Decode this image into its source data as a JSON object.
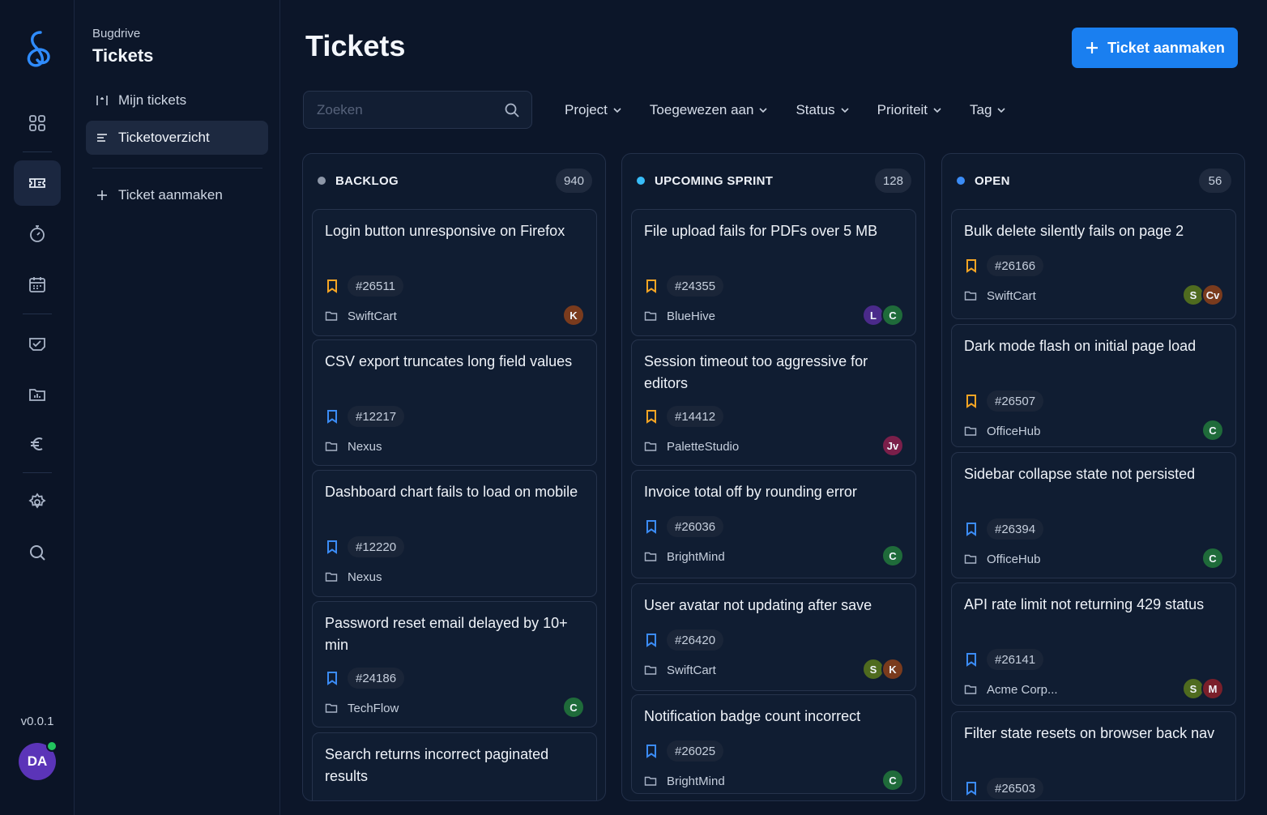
{
  "app": {
    "subtitle": "Bugdrive",
    "title": "Tickets",
    "version": "v0.0.1",
    "user_initials": "DA"
  },
  "nav": {
    "items": [
      {
        "label": "Mijn tickets"
      },
      {
        "label": "Ticketoverzicht"
      },
      {
        "label": "Ticket aanmaken"
      }
    ]
  },
  "header": {
    "title": "Tickets",
    "create_label": "Ticket aanmaken",
    "search_placeholder": "Zoeken"
  },
  "filters": [
    "Project",
    "Toegewezen aan",
    "Status",
    "Prioriteit",
    "Tag"
  ],
  "colors": {
    "accent": "#1a7ff0",
    "backlog": "#8d97a8",
    "sprint": "#38bdf8",
    "open": "#3b8cf6",
    "bookmark_high": "#f5a524",
    "bookmark_normal": "#3b8cf6",
    "online": "#22c55e"
  },
  "columns": [
    {
      "title": "BACKLOG",
      "count": "940",
      "cards": [
        {
          "title": "Login button unresponsive on Firefox",
          "id": "#26511",
          "project": "SwiftCart",
          "bookmark": "orange",
          "avatars": [
            {
              "initials": "K",
              "color": "#7a3b1d"
            }
          ]
        },
        {
          "title": "CSV export truncates long field values",
          "id": "#12217",
          "project": "Nexus",
          "bookmark": "blue",
          "avatars": []
        },
        {
          "title": "Dashboard chart fails to load on mobile",
          "id": "#12220",
          "project": "Nexus",
          "bookmark": "blue",
          "avatars": []
        },
        {
          "title": "Password reset email delayed by 10+ min",
          "id": "#24186",
          "project": "TechFlow",
          "bookmark": "blue",
          "avatars": [
            {
              "initials": "C",
              "color": "#1f6b3a"
            }
          ]
        },
        {
          "title": "Search returns incorrect paginated results",
          "id": "",
          "project": "",
          "bookmark": "blue",
          "avatars": []
        }
      ]
    },
    {
      "title": "UPCOMING SPRINT",
      "count": "128",
      "cards": [
        {
          "title": "File upload fails for PDFs over 5 MB",
          "id": "#24355",
          "project": "BlueHive",
          "bookmark": "orange",
          "avatars": [
            {
              "initials": "L",
              "color": "#4a2a8a"
            },
            {
              "initials": "C",
              "color": "#1f6b3a"
            }
          ]
        },
        {
          "title": "Session timeout too aggressive for editors",
          "id": "#14412",
          "project": "PaletteStudio",
          "bookmark": "orange",
          "avatars": [
            {
              "initials": "Jv",
              "color": "#7a1f4a"
            }
          ]
        },
        {
          "title": "Invoice total off by rounding error",
          "id": "#26036",
          "project": "BrightMind",
          "bookmark": "blue",
          "avatars": [
            {
              "initials": "C",
              "color": "#1f6b3a"
            }
          ]
        },
        {
          "title": "User avatar not updating after save",
          "id": "#26420",
          "project": "SwiftCart",
          "bookmark": "blue",
          "avatars": [
            {
              "initials": "S",
              "color": "#4f6b1f"
            },
            {
              "initials": "K",
              "color": "#7a3b1d"
            }
          ]
        },
        {
          "title": "Notification badge count incorrect",
          "id": "#26025",
          "project": "BrightMind",
          "bookmark": "blue",
          "avatars": [
            {
              "initials": "C",
              "color": "#1f6b3a"
            }
          ]
        }
      ]
    },
    {
      "title": "OPEN",
      "count": "56",
      "cards": [
        {
          "title": "Bulk delete silently fails on page 2",
          "id": "#26166",
          "project": "SwiftCart",
          "bookmark": "orange",
          "avatars": [
            {
              "initials": "S",
              "color": "#4f6b1f"
            },
            {
              "initials": "Cv",
              "color": "#7a3b1d"
            }
          ]
        },
        {
          "title": "Dark mode flash on initial page load",
          "id": "#26507",
          "project": "OfficeHub",
          "bookmark": "orange",
          "avatars": [
            {
              "initials": "C",
              "color": "#1f6b3a"
            }
          ]
        },
        {
          "title": "Sidebar collapse state not persisted",
          "id": "#26394",
          "project": "OfficeHub",
          "bookmark": "blue",
          "avatars": [
            {
              "initials": "C",
              "color": "#1f6b3a"
            }
          ]
        },
        {
          "title": "API rate limit not returning 429 status",
          "id": "#26141",
          "project": "Acme Corp...",
          "bookmark": "blue",
          "avatars": [
            {
              "initials": "S",
              "color": "#4f6b1f"
            },
            {
              "initials": "M",
              "color": "#7a1f2a"
            }
          ]
        },
        {
          "title": "Filter state resets on browser back nav",
          "id": "#26503",
          "project": "",
          "bookmark": "blue",
          "avatars": []
        }
      ]
    }
  ]
}
